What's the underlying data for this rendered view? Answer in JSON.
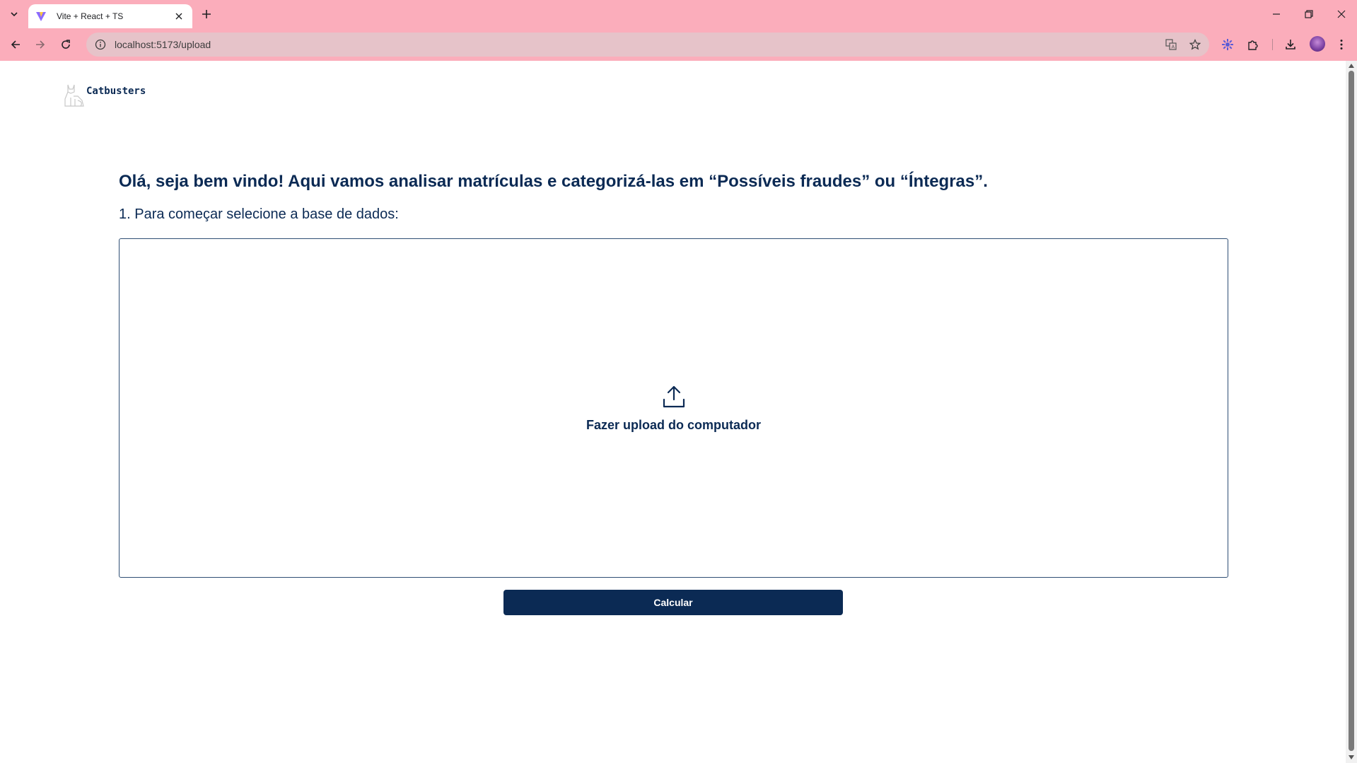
{
  "browser": {
    "tab_title": "Vite + React + TS",
    "url": "localhost:5173/upload",
    "theme_color": "#fbadbb"
  },
  "page": {
    "brand_name": "Catbusters",
    "headline": "Olá, seja bem vindo! Aqui vamos analisar matrículas e categorizá-las em “Possíveis fraudes” ou “Íntegras”.",
    "step_label": "1. Para começar selecione a base de dados:",
    "dropzone": {
      "icon": "upload-icon",
      "label": "Fazer upload do computador"
    },
    "calculate_button": "Calcular",
    "accent_color": "#0b2a54"
  }
}
